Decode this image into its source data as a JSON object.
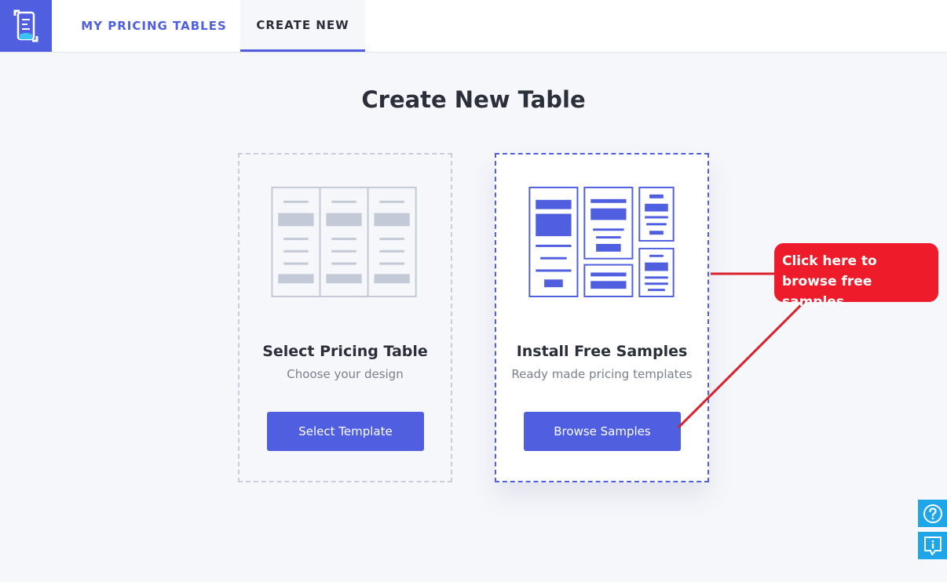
{
  "nav": {
    "tabs": [
      {
        "label": "MY PRICING TABLES"
      },
      {
        "label": "CREATE NEW"
      }
    ],
    "logo_icon": "pricing-table-logo-icon"
  },
  "main": {
    "title": "Create New Table",
    "cards": [
      {
        "title": "Select Pricing Table",
        "subtitle": "Choose your design",
        "button_label": "Select Template",
        "illustration_icon": "blank-columns-icon"
      },
      {
        "title": "Install Free Samples",
        "subtitle": "Ready made pricing templates",
        "button_label": "Browse Samples",
        "illustration_icon": "sample-templates-icon"
      }
    ]
  },
  "callout": {
    "text": "Click here to browse free samples"
  },
  "side_buttons": [
    {
      "icon": "help-icon"
    },
    {
      "icon": "info-chat-icon"
    }
  ],
  "colors": {
    "accent": "#4f5fe0",
    "callout": "#ee1c2b",
    "side": "#1ea6e9"
  }
}
